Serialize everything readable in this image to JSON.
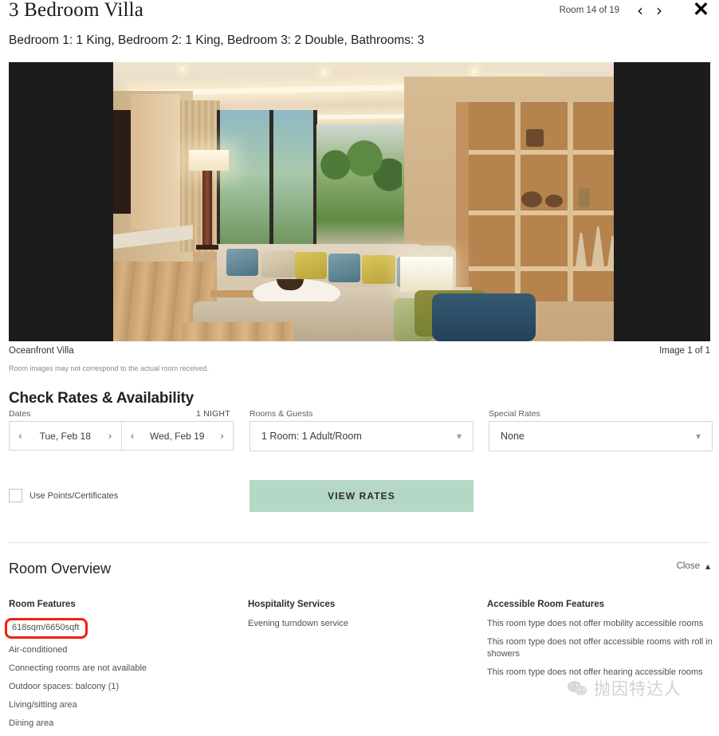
{
  "header": {
    "room_title": "3 Bedroom Villa",
    "room_counter": "Room 14 of 19",
    "prev_icon": "chevron-left-icon",
    "next_icon": "chevron-right-icon",
    "close_icon": "close-x-icon",
    "close_glyph": "✕",
    "prev_glyph": "‹",
    "next_glyph": "›"
  },
  "bed_config": "Bedroom 1: 1 King, Bedroom 2: 1 King, Bedroom 3: 2 Double, Bathrooms: 3",
  "gallery": {
    "caption": "Oceanfront Villa",
    "image_count": "Image 1 of 1",
    "disclaimer": "Room images may not correspond to the actual room received."
  },
  "check_rates": {
    "title": "Check Rates & Availability",
    "dates_label": "Dates",
    "nights": "1 NIGHT",
    "check_in": "Tue, Feb 18",
    "check_out": "Wed, Feb 19",
    "rooms_guests_label": "Rooms & Guests",
    "rooms_guests_value": "1 Room: 1 Adult/Room",
    "special_rates_label": "Special Rates",
    "special_rates_value": "None",
    "use_points_label": "Use Points/Certificates",
    "view_rates_label": "VIEW RATES",
    "view_rates_color": "#b5d7c5"
  },
  "room_overview": {
    "title": "Room Overview",
    "close_label": "Close",
    "close_chevron": "˄",
    "columns": [
      {
        "header": "Room Features",
        "items": [
          "618sqm/6650sqft",
          "Air-conditioned",
          "Connecting rooms are not available",
          "Outdoor spaces: balcony (1)",
          "Living/sitting area",
          "Dining area"
        ],
        "highlighted_index": 0,
        "highlight_color": "#ee2211"
      },
      {
        "header": "Hospitality Services",
        "items": [
          "Evening turndown service"
        ],
        "highlighted_index": -1
      },
      {
        "header": "Accessible Room Features",
        "items": [
          "This room type does not offer mobility accessible rooms",
          "This room type does not offer accessible rooms with roll in showers",
          "This room type does not offer hearing accessible rooms"
        ],
        "highlighted_index": -1
      }
    ]
  },
  "watermark": {
    "text": "抛因特达人",
    "icon": "wechat-icon"
  }
}
